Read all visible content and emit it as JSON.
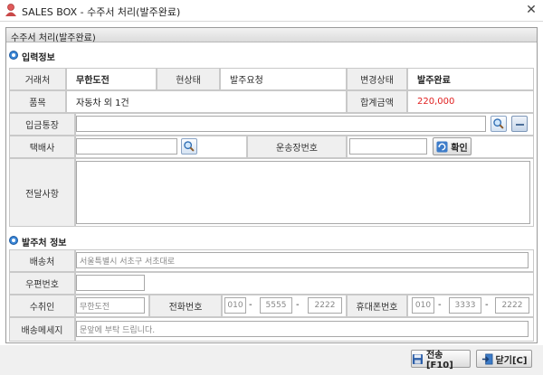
{
  "window": {
    "title": "SALES BOX - 수주서 처리(발주완료)",
    "close_glyph": "✕",
    "app_icon": "person-icon"
  },
  "panel": {
    "header": "수주서 처리(발주완료)"
  },
  "input_section": {
    "title": "입력정보",
    "client_label": "거래처",
    "client_value": "무한도전",
    "status_label": "현상태",
    "status_value": "발주요청",
    "change_label": "변경상태",
    "change_value": "발주완료",
    "item_label": "품목",
    "item_value": "자동차 외 1건",
    "total_label": "합계금액",
    "total_value": "220,000",
    "account_label": "입금통장",
    "account_value": "",
    "courier_label": "택배사",
    "courier_value": "",
    "tracking_label": "운송장번호",
    "tracking_value": "",
    "confirm_label": "확인",
    "note_label": "전달사항",
    "note_value": ""
  },
  "order_section": {
    "title": "발주처 정보",
    "address_label": "배송처",
    "address_value": "서울특별시 서초구 서초대로",
    "zip_label": "우편번호",
    "zip_value": "",
    "recipient_label": "수취인",
    "recipient_value": "무한도전",
    "phone_label": "전화번호",
    "phone": [
      "010",
      "5555",
      "2222"
    ],
    "mobile_label": "휴대폰번호",
    "mobile": [
      "010",
      "3333",
      "2222"
    ],
    "dash": "-",
    "message_label": "배송메세지",
    "message_value": "문앞에 부탁 드립니다."
  },
  "footer": {
    "send_label": "전송[F10]",
    "close_label": "닫기[C]"
  },
  "colors": {
    "accent": "#3a86d6",
    "amount": "#e02020"
  }
}
